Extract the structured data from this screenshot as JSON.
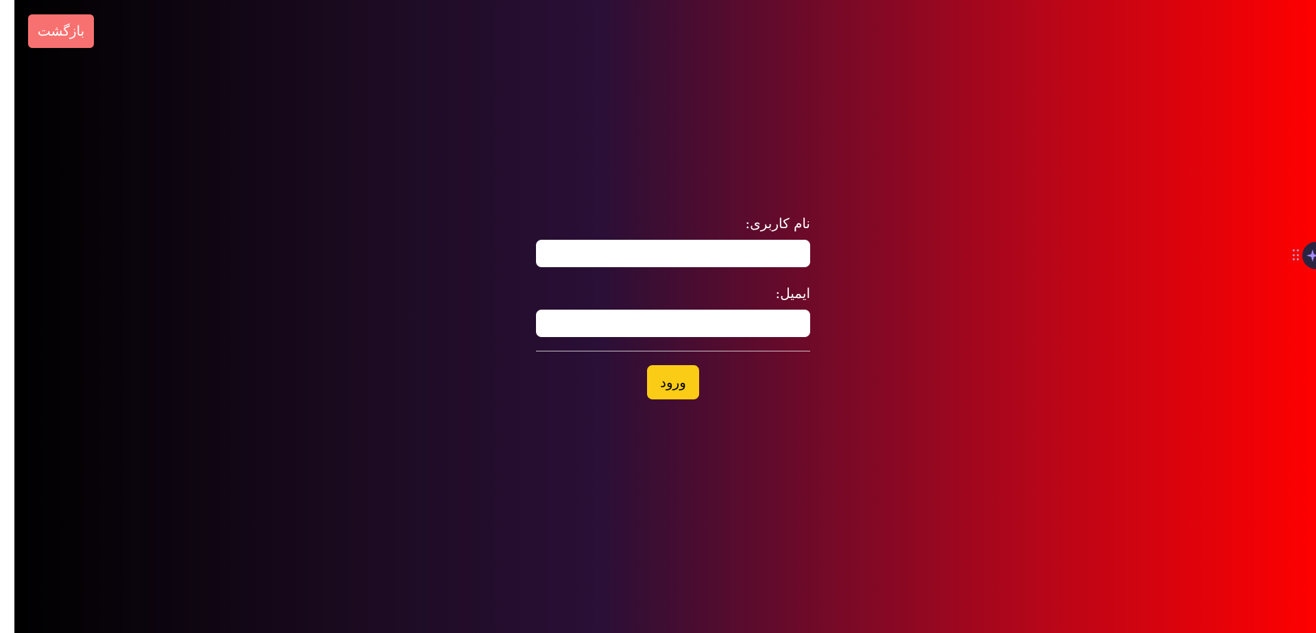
{
  "header": {
    "back_label": "بازگشت"
  },
  "form": {
    "username_label": "نام کاربری:",
    "username_value": "",
    "email_label": "ایمیل:",
    "email_value": "",
    "submit_label": "ورود"
  },
  "colors": {
    "back_button": "#f87171",
    "submit_button": "#facc15",
    "gradient_start": "#000000",
    "gradient_mid": "#2a0f36",
    "gradient_end": "#ff0000"
  },
  "icons": {
    "side_widget": "sparkle-icon",
    "drag_handle": "drag-handle-icon"
  }
}
